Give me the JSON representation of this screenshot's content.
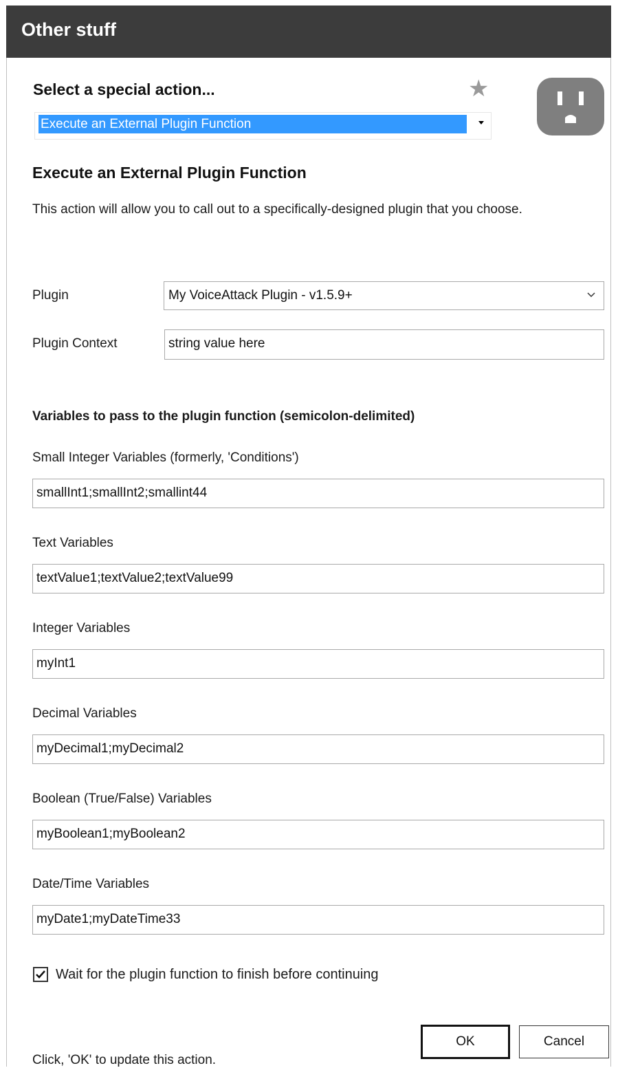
{
  "window": {
    "title": "Other stuff"
  },
  "action_selector": {
    "heading": "Select a special action...",
    "selected": "Execute an External Plugin Function"
  },
  "icons": {
    "favorite": "star-icon",
    "plugin": "outlet-plug-icon"
  },
  "section": {
    "title": "Execute an External Plugin Function",
    "description": "This action will allow you to call out to a specifically-designed plugin that you choose."
  },
  "plugin": {
    "label": "Plugin",
    "selected": "My VoiceAttack Plugin - v1.5.9+",
    "context_label": "Plugin Context",
    "context_value": "string value here"
  },
  "variables": {
    "heading": "Variables to pass to the plugin function (semicolon-delimited)",
    "small_int_label": "Small Integer Variables (formerly, 'Conditions')",
    "small_int_value": "smallInt1;smallInt2;smallint44",
    "text_label": "Text Variables",
    "text_value": "textValue1;textValue2;textValue99",
    "int_label": "Integer Variables",
    "int_value": "myInt1",
    "decimal_label": "Decimal Variables",
    "decimal_value": "myDecimal1;myDecimal2",
    "boolean_label": "Boolean (True/False) Variables",
    "boolean_value": "myBoolean1;myBoolean2",
    "datetime_label": "Date/Time Variables",
    "datetime_value": "myDate1;myDateTime33"
  },
  "wait": {
    "label": "Wait for the plugin function to finish before continuing",
    "checked": true
  },
  "footer": {
    "hint": "Click, 'OK' to update this action.",
    "ok_label": "OK",
    "cancel_label": "Cancel"
  },
  "colors": {
    "titlebar": "#3c3c3c",
    "selection": "#3399ff",
    "icon_gray": "#7f7f7f"
  }
}
